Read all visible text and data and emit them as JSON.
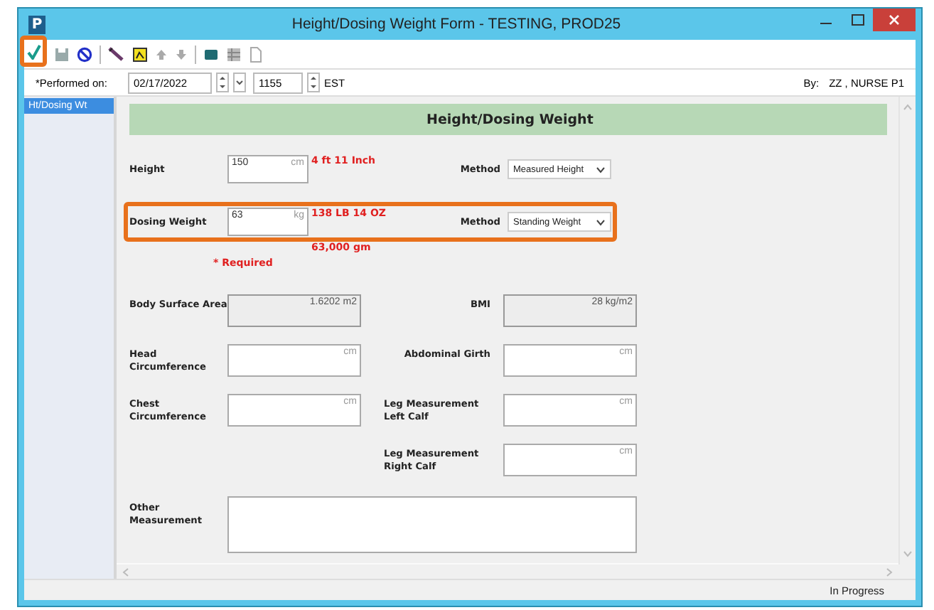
{
  "window": {
    "app_icon": "P",
    "title": "Height/Dosing Weight Form - TESTING, PROD25"
  },
  "toolbar": {
    "sign_highlighted": true
  },
  "performed": {
    "label": "*Performed on:",
    "date": "02/17/2022",
    "time": "1155",
    "timezone": "EST"
  },
  "by": {
    "label": "By:",
    "value": "ZZ , NURSE P1"
  },
  "sidebar": {
    "items": [
      {
        "label": "Ht/Dosing Wt",
        "selected": true
      }
    ]
  },
  "section_title": "Height/Dosing Weight",
  "primary_rows": [
    {
      "label": "Height",
      "value": "150",
      "unit": "cm",
      "conversions": [
        "4 ft 11 Inch"
      ],
      "method_label": "Method",
      "method": "Measured Height",
      "highlighted": false
    },
    {
      "label": "Dosing Weight",
      "value": "63",
      "unit": "kg",
      "conversions": [
        "138 LB 14 OZ",
        "63,000 gm"
      ],
      "method_label": "Method",
      "method": "Standing Weight",
      "highlighted": true
    }
  ],
  "required_note": "* Required",
  "measurement_rows": [
    {
      "left": {
        "label": "Body Surface Area",
        "value": "1.6202 m2",
        "readonly": true
      },
      "right": {
        "label": "BMI",
        "value": "28 kg/m2",
        "readonly": true
      }
    },
    {
      "left": {
        "label": "Head Circumference",
        "unit": "cm",
        "readonly": false
      },
      "right": {
        "label": "Abdominal Girth",
        "unit": "cm",
        "readonly": false
      }
    },
    {
      "left": {
        "label": "Chest Circumference",
        "unit": "cm",
        "readonly": false
      },
      "right": {
        "label": "Leg Measurement Left Calf",
        "unit": "cm",
        "readonly": false
      }
    },
    {
      "right": {
        "label": "Leg Measurement Right Calf",
        "unit": "cm",
        "readonly": false
      }
    }
  ],
  "other": {
    "label": "Other Measurement"
  },
  "status": "In Progress"
}
